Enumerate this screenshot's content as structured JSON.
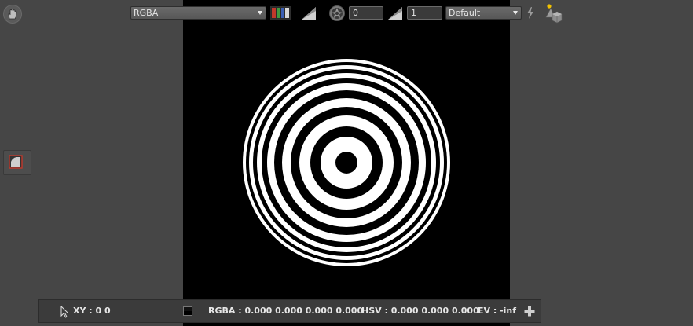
{
  "toolbar": {
    "channels": {
      "value": "RGBA"
    },
    "gain": {
      "value": "0"
    },
    "gamma": {
      "value": "1"
    },
    "lut": {
      "value": "Default"
    }
  },
  "status_bar": {
    "xy": "XY : 0 0",
    "rgba": "RGBA : 0.000 0.000 0.000 0.000",
    "hsv": "HSV : 0.000 0.000 0.000",
    "ev": "EV : -inf"
  },
  "colors": {
    "background": "#464646",
    "viewport": "#000000",
    "status_bar": "#3b3b3b",
    "channel_red": "#c0392b",
    "channel_green": "#3f9a3f",
    "channel_blue": "#3b5fb4",
    "channel_alpha": "#d8d8d8",
    "indicator_dot": "#f2c200"
  },
  "icons": {
    "pan_tool": "hand-icon",
    "channel_selector": "rgb-channels-icon",
    "gain_ramp": "ramp-icon",
    "exposure": "aperture-icon",
    "gamma_ramp": "ramp-icon",
    "auto_contrast": "lightning-icon",
    "viewer_objects": "objects-icon",
    "left_tool": "curve-tool-icon",
    "pointer": "cursor-icon",
    "add": "plus-icon"
  }
}
